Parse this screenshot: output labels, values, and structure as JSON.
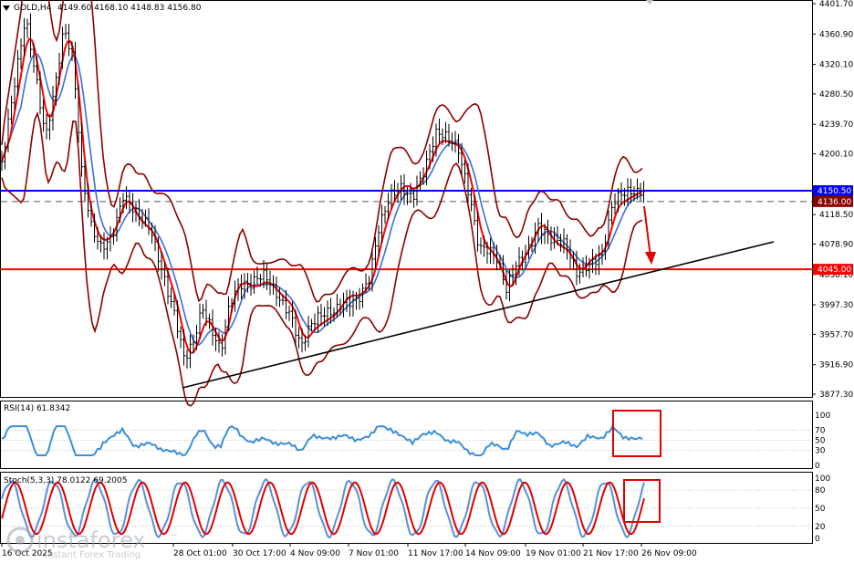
{
  "header": {
    "symbol_text": "GOLD,H4",
    "ohlc_text": "4149.60 4168.10 4148.83 4156.80"
  },
  "price_axis": {
    "ticks": [
      "4401.70",
      "4360.90",
      "4320.10",
      "4280.50",
      "4239.70",
      "4200.10",
      "4118.50",
      "4078.90",
      "4038.10",
      "3997.30",
      "3957.70",
      "3916.90",
      "3877.30"
    ],
    "current_price": "4150.50",
    "dashed_level": "4136.00",
    "support_level": "4045.00"
  },
  "time_axis": {
    "labels": [
      "16 Oct 2025",
      "28 Oct 01:00",
      "30 Oct 17:00",
      "4 Nov 09:00",
      "7 Nov 01:00",
      "11 Nov 17:00",
      "14 Nov 09:00",
      "19 Nov 01:00",
      "21 Nov 17:00",
      "26 Nov 09:00"
    ]
  },
  "rsi": {
    "title": "RSI(14) 61.8342",
    "ticks": [
      "100",
      "70",
      "50",
      "30",
      "0"
    ]
  },
  "stoch": {
    "title": "Stoch(5,3,3) 78.0122 69.2005",
    "ticks": [
      "100",
      "80",
      "50",
      "20",
      "0"
    ]
  },
  "watermark": {
    "brand": "instaforex",
    "tagline": "Instant Forex Trading"
  },
  "colors": {
    "price_line": "#0000ff",
    "support_line": "#ff0000",
    "bollinger": "#8b0000",
    "ma_fast": "#ff0000",
    "ma_slow": "#3a6fd8",
    "rsi_line": "#3a8fd8",
    "stoch_main": "#5b8fd8",
    "stoch_signal": "#e00000",
    "trendline": "#000000",
    "annotation": "#e00000"
  },
  "chart_data": {
    "type": "line",
    "title": "GOLD,H4",
    "ylim": [
      3877.3,
      4401.7
    ],
    "x": [
      "16 Oct 2025",
      "28 Oct 01:00",
      "30 Oct 17:00",
      "4 Nov 09:00",
      "7 Nov 01:00",
      "11 Nov 17:00",
      "14 Nov 09:00",
      "19 Nov 01:00",
      "21 Nov 17:00",
      "26 Nov 09:00"
    ],
    "series": [
      {
        "name": "close",
        "values": [
          4200,
          3930,
          4010,
          3950,
          4010,
          4220,
          4060,
          4080,
          4050,
          4156.8
        ]
      }
    ],
    "levels": [
      {
        "value": 4150.5
      },
      {
        "value": 4136.0
      },
      {
        "value": 4045.0
      }
    ],
    "indicators": {
      "rsi": {
        "period": 14,
        "last": 61.8342
      },
      "stochastic": {
        "params": [
          5,
          3,
          3
        ],
        "main": 78.0122,
        "signal": 69.2005
      }
    }
  }
}
